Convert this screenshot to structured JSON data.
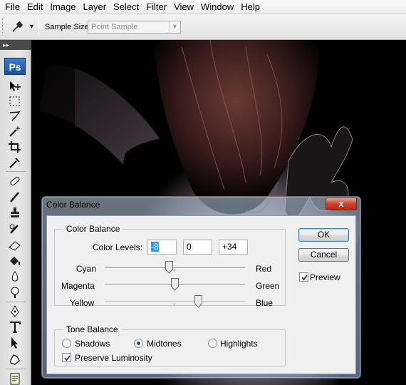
{
  "menu": [
    "File",
    "Edit",
    "Image",
    "Layer",
    "Select",
    "Filter",
    "View",
    "Window",
    "Help"
  ],
  "options": {
    "sample_size_label": "Sample Size:",
    "sample_size_value": "Point Sample"
  },
  "toolbar": {
    "logo": "Ps",
    "tools": [
      "move-icon",
      "marquee-icon",
      "lasso-icon",
      "magic-wand-icon",
      "crop-icon",
      "eyedropper-icon",
      "healing-brush-icon",
      "brush-icon",
      "clone-stamp-icon",
      "history-brush-icon",
      "eraser-icon",
      "paint-bucket-icon",
      "blur-icon",
      "dodge-icon",
      "pen-icon",
      "type-icon",
      "path-selection-icon",
      "shape-icon",
      "notes-icon"
    ]
  },
  "dialog": {
    "title": "Color Balance",
    "close_label": "x",
    "color_balance_group": "Color Balance",
    "color_levels_label": "Color Levels:",
    "levels": [
      "-8",
      "0",
      "+34"
    ],
    "sliders": [
      {
        "left": "Cyan",
        "right": "Red",
        "value": -8
      },
      {
        "left": "Magenta",
        "right": "Green",
        "value": 0
      },
      {
        "left": "Yellow",
        "right": "Blue",
        "value": 34
      }
    ],
    "tone_group": "Tone Balance",
    "tones": [
      "Shadows",
      "Midtones",
      "Highlights"
    ],
    "selected_tone": "Midtones",
    "preserve_luminosity_label": "Preserve Luminosity",
    "preserve_luminosity_checked": true,
    "ok_label": "OK",
    "cancel_label": "Cancel",
    "preview_label": "Preview",
    "preview_checked": true
  }
}
